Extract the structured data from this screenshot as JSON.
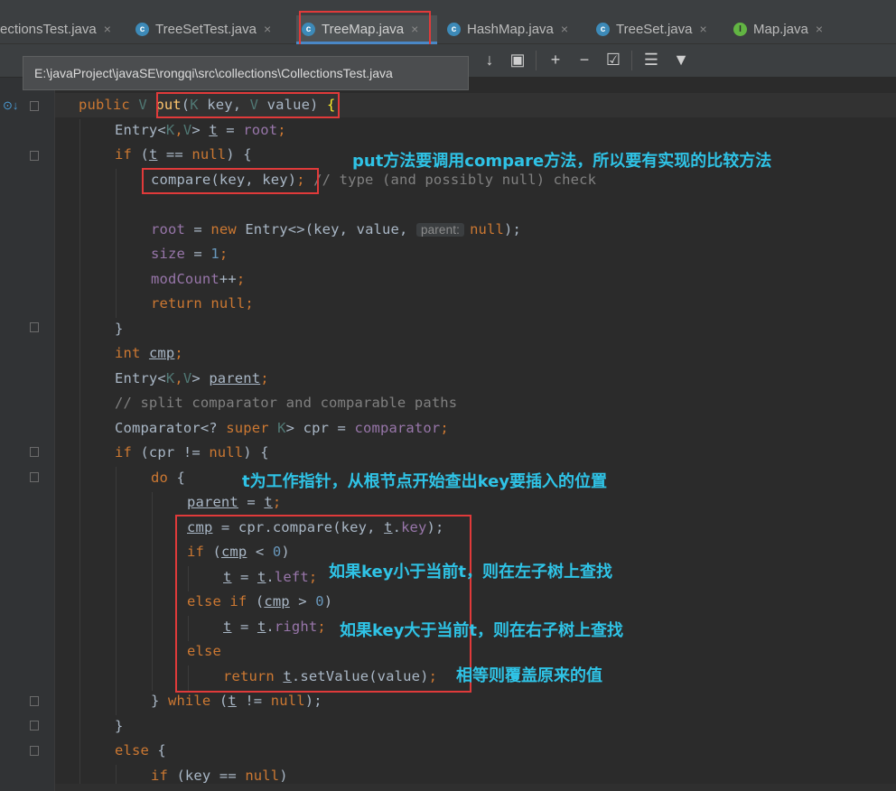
{
  "tabs": [
    {
      "label": "CollectionsTest.java",
      "visible": "ectionsTest.java",
      "icon": "class-icon"
    },
    {
      "label": "TreeSetTest.java",
      "icon": "class-icon"
    },
    {
      "label": "TreeMap.java",
      "icon": "class-icon",
      "active": true
    },
    {
      "label": "HashMap.java",
      "icon": "class-icon"
    },
    {
      "label": "TreeSet.java",
      "icon": "class-icon"
    },
    {
      "label": "Map.java",
      "icon": "interface-icon"
    }
  ],
  "tab_close": "×",
  "tooltip": "E:\\javaProject\\javaSE\\rongqi\\src\\collections\\CollectionsTest.java",
  "code": {
    "l1": {
      "a": "public ",
      "b": "V ",
      "c": "put",
      "d": "(",
      "e": "K ",
      "f": "key, ",
      "g": "V ",
      "h": "value) ",
      "i": "{"
    },
    "l2": {
      "a": "Entry<",
      "b": "K",
      "c": ",",
      "d": "V",
      "e": "> ",
      "f": "t",
      "g": " = ",
      "h": "root",
      "i": ";"
    },
    "l3": {
      "a": "if ",
      "b": "(",
      "c": "t",
      "d": " == ",
      "e": "null",
      "f": ") {"
    },
    "l4": {
      "a": "compare(key, key)",
      "b": ";",
      "c": " // type (and possibly null) check"
    },
    "l5": {
      "a": "root",
      "b": " = ",
      "c": "new ",
      "d": "Entry<>(key, value, ",
      "e": "parent:",
      "f": "null",
      "g": ");"
    },
    "l6": {
      "a": "size",
      "b": " = ",
      "c": "1",
      "d": ";"
    },
    "l7": {
      "a": "modCount",
      "b": "++",
      "c": ";"
    },
    "l8": {
      "a": "return null",
      "b": ";"
    },
    "l9": "}",
    "l10": {
      "a": "int ",
      "b": "cmp",
      "c": ";"
    },
    "l11": {
      "a": "Entry<",
      "b": "K",
      "c": ",",
      "d": "V",
      "e": "> ",
      "f": "parent",
      "g": ";"
    },
    "l12": "// split comparator and comparable paths",
    "l13": {
      "a": "Comparator<? ",
      "b": "super ",
      "c": "K",
      "d": "> cpr = ",
      "e": "comparator",
      "f": ";"
    },
    "l14": {
      "a": "if ",
      "b": "(cpr != ",
      "c": "null",
      "d": ") {"
    },
    "l15": {
      "a": "do ",
      "b": "{"
    },
    "l16": {
      "a": "parent",
      "b": " = ",
      "c": "t",
      "d": ";"
    },
    "l17": {
      "a": "cmp",
      "b": " = cpr.compare(key, ",
      "c": "t",
      "d": ".",
      "e": "key",
      "f": ");"
    },
    "l18": {
      "a": "if ",
      "b": "(",
      "c": "cmp",
      "d": " < ",
      "e": "0",
      "f": ")"
    },
    "l19": {
      "a": "t",
      "b": " = ",
      "c": "t",
      "d": ".",
      "e": "left",
      "f": ";"
    },
    "l20": {
      "a": "else if ",
      "b": "(",
      "c": "cmp",
      "d": " > ",
      "e": "0",
      "f": ")"
    },
    "l21": {
      "a": "t",
      "b": " = ",
      "c": "t",
      "d": ".",
      "e": "right",
      "f": ";"
    },
    "l22": "else",
    "l23": {
      "a": "return ",
      "b": "t",
      "c": ".setValue(value)",
      "d": ";"
    },
    "l24": {
      "a": "} ",
      "b": "while ",
      "c": "(",
      "d": "t",
      "e": " != ",
      "f": "null",
      "g": ");"
    },
    "l25": "}",
    "l26": {
      "a": "else ",
      "b": "{"
    },
    "l27": {
      "a": "if ",
      "b": "(key == ",
      "c": "null",
      "d": ")"
    }
  },
  "annotations": {
    "a1": "put方法要调用compare方法，所以要有实现的比较方法",
    "a2": "t为工作指针，从根节点开始查出key要插入的位置",
    "a3": "如果key小于当前t，则在左子树上查找",
    "a4": "如果key大于当前t，则在右子树上查找",
    "a5": "相等则覆盖原来的值"
  },
  "colors": {
    "annotation": "#2fc3e6",
    "highlight_box": "#e03a3a",
    "keyword": "#cc7832"
  }
}
